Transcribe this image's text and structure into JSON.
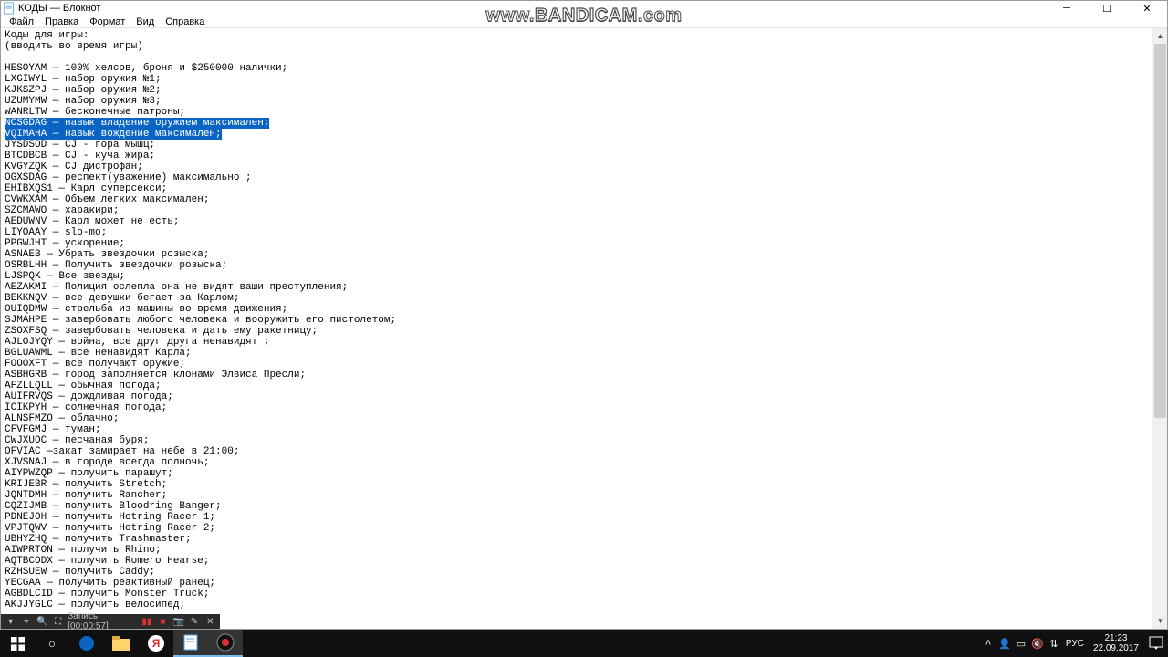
{
  "window": {
    "title": "КОДЫ — Блокнот"
  },
  "menu": {
    "file": "Файл",
    "edit": "Правка",
    "format": "Формат",
    "view": "Вид",
    "help": "Справка"
  },
  "doc": {
    "lines": [
      {
        "t": "Коды для игры:",
        "sel": false
      },
      {
        "t": "(вводить во время игры)",
        "sel": false
      },
      {
        "t": "",
        "sel": false
      },
      {
        "t": "HESOYAM — 100% хелсов, броня и $250000 налички;",
        "sel": false
      },
      {
        "t": "LXGIWYL — набор оружия №1;",
        "sel": false
      },
      {
        "t": "KJKSZPJ — набор оружия №2;",
        "sel": false
      },
      {
        "t": "UZUMYMW — набор оружия №3;",
        "sel": false
      },
      {
        "t": "WANRLTW — бесконечные патроны;",
        "sel": false
      },
      {
        "t": "NCSGDAG — навык владение оружием максимален;",
        "sel": true
      },
      {
        "t": "VQIMAHA — навык вождение максимален;",
        "sel": true
      },
      {
        "t": "JYSDSOD — CJ - гора мышц;",
        "sel": false
      },
      {
        "t": "BTCDBCB — CJ - куча жира;",
        "sel": false
      },
      {
        "t": "KVGYZQK — CJ дистрофан;",
        "sel": false
      },
      {
        "t": "OGXSDAG — респект(уважение) максимально ;",
        "sel": false
      },
      {
        "t": "EHIBXQS1 — Карл суперсекси;",
        "sel": false
      },
      {
        "t": "CVWKXAM — Объем легких максимален;",
        "sel": false
      },
      {
        "t": "SZCMAWO — харакири;",
        "sel": false
      },
      {
        "t": "AEDUWNV — Карл может не есть;",
        "sel": false
      },
      {
        "t": "LIYOAAY — slo-mo;",
        "sel": false
      },
      {
        "t": "PPGWJHT — ускорение;",
        "sel": false
      },
      {
        "t": "ASNAEB — Убрать звездочки розыска;",
        "sel": false
      },
      {
        "t": "OSRBLHH — Получить звездочки розыска;",
        "sel": false
      },
      {
        "t": "LJSPQK — Все звезды;",
        "sel": false
      },
      {
        "t": "AEZAKMI — Полиция ослепла она не видят ваши преступления;",
        "sel": false
      },
      {
        "t": "BEKKNQV — все девушки бегает за Карлом;",
        "sel": false
      },
      {
        "t": "OUIQDMW — стрельба из машины во время движения;",
        "sel": false
      },
      {
        "t": "SJMAHPE — завербовать любого человека и вооружить его пистолетом;",
        "sel": false
      },
      {
        "t": "ZSOXFSQ — завербовать человека и дать ему ракетницу;",
        "sel": false
      },
      {
        "t": "AJLOJYQY — война, все друг друга ненавидят ;",
        "sel": false
      },
      {
        "t": "BGLUAWML — все ненавидят Карла;",
        "sel": false
      },
      {
        "t": "FOOOXFT — все получают оружие;",
        "sel": false
      },
      {
        "t": "ASBHGRB — город заполняется клонами Элвиса Пресли;",
        "sel": false
      },
      {
        "t": "AFZLLQLL — обычная погода;",
        "sel": false
      },
      {
        "t": "AUIFRVQS — дождливая погода;",
        "sel": false
      },
      {
        "t": "ICIKPYH — солнечная погода;",
        "sel": false
      },
      {
        "t": "ALNSFMZO — облачно;",
        "sel": false
      },
      {
        "t": "CFVFGMJ — туман;",
        "sel": false
      },
      {
        "t": "CWJXUOC — песчаная буря;",
        "sel": false
      },
      {
        "t": "OFVIAC —закат замирает на небе в 21:00;",
        "sel": false
      },
      {
        "t": "XJVSNAJ — в городе всегда полночь;",
        "sel": false
      },
      {
        "t": "AIYPWZQP — получить парашут;",
        "sel": false
      },
      {
        "t": "KRIJEBR — получить Stretch;",
        "sel": false
      },
      {
        "t": "JQNTDMH — получить Rancher;",
        "sel": false
      },
      {
        "t": "CQZIJMB — получить Bloodring Banger;",
        "sel": false
      },
      {
        "t": "PDNEJOH — получить Hotring Racer 1;",
        "sel": false
      },
      {
        "t": "VPJTQWV — получить Hotring Racer 2;",
        "sel": false
      },
      {
        "t": "UBHYZHQ — получить Trashmaster;",
        "sel": false
      },
      {
        "t": "AIWPRTON — получить Rhino;",
        "sel": false
      },
      {
        "t": "AQTBCODX — получить Romero Hearse;",
        "sel": false
      },
      {
        "t": "RZHSUEW — получить Caddy;",
        "sel": false
      },
      {
        "t": "YECGAA — получить реактивный ранец;",
        "sel": false
      },
      {
        "t": "AGBDLCID — получить Monster Truck;",
        "sel": false
      },
      {
        "t": "AKJJYGLC — получить велосипед;",
        "sel": false
      }
    ]
  },
  "bandicam": {
    "rec_label": "Запись [00:00:57]",
    "watermark": "www.BANDICAM.com"
  },
  "taskbar": {
    "lang": "РУС",
    "time": "21:23",
    "date": "22.09.2017"
  }
}
